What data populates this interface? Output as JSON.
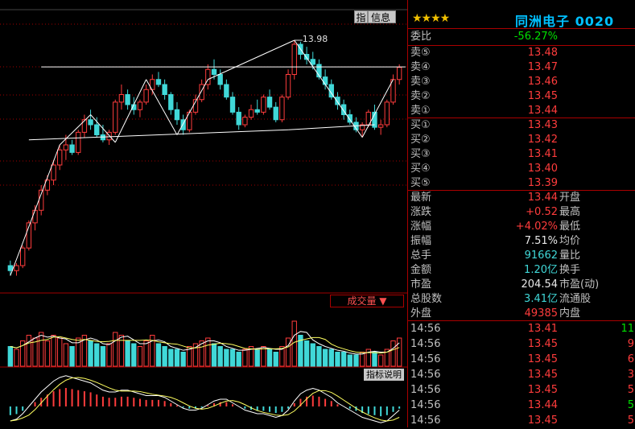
{
  "chart": {
    "buttons": {
      "zhi": "指",
      "info": "信息"
    },
    "high_label": "13.98",
    "volume_label": "成交量 ▼",
    "indicator_button": "指标说明"
  },
  "stock": {
    "stars": "★★★★",
    "title": "同洲电子 0020",
    "weibi": {
      "label": "委比",
      "value": "-56.27%"
    },
    "asks": [
      {
        "label": "卖⑤",
        "price": "13.48"
      },
      {
        "label": "卖④",
        "price": "13.47"
      },
      {
        "label": "卖③",
        "price": "13.46"
      },
      {
        "label": "卖②",
        "price": "13.45"
      },
      {
        "label": "卖①",
        "price": "13.44"
      }
    ],
    "bids": [
      {
        "label": "买①",
        "price": "13.43"
      },
      {
        "label": "买②",
        "price": "13.42"
      },
      {
        "label": "买③",
        "price": "13.41"
      },
      {
        "label": "买④",
        "price": "13.40"
      },
      {
        "label": "买⑤",
        "price": "13.39"
      }
    ],
    "stats": [
      {
        "label": "最新",
        "value": "13.44",
        "label2": "开盘",
        "color": "red"
      },
      {
        "label": "涨跌",
        "value": "+0.52",
        "label2": "最高",
        "color": "red"
      },
      {
        "label": "涨幅",
        "value": "+4.02%",
        "label2": "最低",
        "color": "red"
      },
      {
        "label": "振幅",
        "value": "7.51%",
        "label2": "均价",
        "color": "white"
      },
      {
        "label": "总手",
        "value": "91662",
        "label2": "量比",
        "color": "cyan"
      },
      {
        "label": "金额",
        "value": "1.20亿",
        "label2": "换手",
        "color": "cyan"
      },
      {
        "label": "市盈",
        "value": "204.54",
        "label2": "市盈(动)",
        "color": "white"
      },
      {
        "label": "总股数",
        "value": "3.41亿",
        "label2": "流通股",
        "color": "cyan"
      },
      {
        "label": "外盘",
        "value": "49385",
        "label2": "内盘",
        "color": "red"
      }
    ],
    "ticks": [
      {
        "time": "14:56",
        "price": "13.41",
        "vol": "11",
        "color": "green"
      },
      {
        "time": "14:56",
        "price": "13.45",
        "vol": "9",
        "color": "red"
      },
      {
        "time": "14:56",
        "price": "13.45",
        "vol": "6",
        "color": "red"
      },
      {
        "time": "14:56",
        "price": "13.45",
        "vol": "3",
        "color": "red"
      },
      {
        "time": "14:56",
        "price": "13.45",
        "vol": "5",
        "color": "red"
      },
      {
        "time": "14:56",
        "price": "13.44",
        "vol": "5",
        "color": "green"
      },
      {
        "time": "14:56",
        "price": "13.45",
        "vol": "5",
        "color": "red"
      }
    ]
  },
  "chart_data": {
    "type": "candlestick",
    "title": "",
    "high_marker": 13.98,
    "colors": {
      "up": "#ff3c3c",
      "down": "#40d8d8",
      "trendline": "#ffffff",
      "grid": "#a00000"
    },
    "candles": [
      [
        9.5,
        9.6,
        9.3,
        9.4
      ],
      [
        9.4,
        9.55,
        9.3,
        9.5
      ],
      [
        9.5,
        9.9,
        9.45,
        9.85
      ],
      [
        9.85,
        10.4,
        9.8,
        10.35
      ],
      [
        10.35,
        10.7,
        10.2,
        10.6
      ],
      [
        10.6,
        11.1,
        10.5,
        11.0
      ],
      [
        11.0,
        11.3,
        10.9,
        11.2
      ],
      [
        11.2,
        11.6,
        11.1,
        11.5
      ],
      [
        11.5,
        11.9,
        11.4,
        11.8
      ],
      [
        11.8,
        12.1,
        11.6,
        11.9
      ],
      [
        11.9,
        12.0,
        11.7,
        11.75
      ],
      [
        11.75,
        12.2,
        11.7,
        12.15
      ],
      [
        12.15,
        12.5,
        12.05,
        12.4
      ],
      [
        12.4,
        12.6,
        12.2,
        12.3
      ],
      [
        12.3,
        12.45,
        12.05,
        12.1
      ],
      [
        12.1,
        12.3,
        11.95,
        12.0
      ],
      [
        12.0,
        12.2,
        11.9,
        12.15
      ],
      [
        12.15,
        12.8,
        12.1,
        12.75
      ],
      [
        12.75,
        13.1,
        12.6,
        12.9
      ],
      [
        12.9,
        13.0,
        12.6,
        12.7
      ],
      [
        12.7,
        12.85,
        12.5,
        12.6
      ],
      [
        12.6,
        12.8,
        12.45,
        12.75
      ],
      [
        12.75,
        13.1,
        12.7,
        13.0
      ],
      [
        13.0,
        13.3,
        12.9,
        13.2
      ],
      [
        13.2,
        13.35,
        13.05,
        13.1
      ],
      [
        13.1,
        13.2,
        12.8,
        12.9
      ],
      [
        12.9,
        12.95,
        12.5,
        12.6
      ],
      [
        12.6,
        12.75,
        12.3,
        12.4
      ],
      [
        12.4,
        12.5,
        12.1,
        12.2
      ],
      [
        12.2,
        12.6,
        12.15,
        12.55
      ],
      [
        12.55,
        12.9,
        12.5,
        12.8
      ],
      [
        12.8,
        13.2,
        12.75,
        13.1
      ],
      [
        13.1,
        13.5,
        13.0,
        13.4
      ],
      [
        13.4,
        13.6,
        13.2,
        13.3
      ],
      [
        13.3,
        13.4,
        13.0,
        13.1
      ],
      [
        13.1,
        13.2,
        12.8,
        12.85
      ],
      [
        12.85,
        12.95,
        12.5,
        12.55
      ],
      [
        12.55,
        12.65,
        12.2,
        12.3
      ],
      [
        12.3,
        12.5,
        12.25,
        12.45
      ],
      [
        12.45,
        12.7,
        12.4,
        12.6
      ],
      [
        12.6,
        12.8,
        12.5,
        12.55
      ],
      [
        12.55,
        12.9,
        12.5,
        12.85
      ],
      [
        12.85,
        13.0,
        12.6,
        12.65
      ],
      [
        12.65,
        12.75,
        12.35,
        12.4
      ],
      [
        12.4,
        12.9,
        12.35,
        12.85
      ],
      [
        12.85,
        13.4,
        12.8,
        13.3
      ],
      [
        13.3,
        13.98,
        13.2,
        13.9
      ],
      [
        13.9,
        13.95,
        13.6,
        13.7
      ],
      [
        13.7,
        13.85,
        13.5,
        13.6
      ],
      [
        13.6,
        13.75,
        13.4,
        13.5
      ],
      [
        13.5,
        13.6,
        13.2,
        13.25
      ],
      [
        13.25,
        13.4,
        13.0,
        13.1
      ],
      [
        13.1,
        13.2,
        12.8,
        12.85
      ],
      [
        12.85,
        12.95,
        12.6,
        12.7
      ],
      [
        12.7,
        12.8,
        12.4,
        12.5
      ],
      [
        12.5,
        12.6,
        12.3,
        12.35
      ],
      [
        12.35,
        12.45,
        12.15,
        12.2
      ],
      [
        12.2,
        12.35,
        12.05,
        12.3
      ],
      [
        12.3,
        12.6,
        12.25,
        12.55
      ],
      [
        12.55,
        12.7,
        12.2,
        12.25
      ],
      [
        12.25,
        12.4,
        12.1,
        12.3
      ],
      [
        12.3,
        12.8,
        12.25,
        12.75
      ],
      [
        12.75,
        13.3,
        12.7,
        13.2
      ],
      [
        13.2,
        13.5,
        13.1,
        13.44
      ]
    ],
    "volumes": [
      0.35,
      0.3,
      0.45,
      0.55,
      0.5,
      0.6,
      0.45,
      0.55,
      0.5,
      0.4,
      0.35,
      0.5,
      0.55,
      0.45,
      0.4,
      0.35,
      0.4,
      0.6,
      0.55,
      0.45,
      0.4,
      0.35,
      0.45,
      0.55,
      0.4,
      0.35,
      0.3,
      0.3,
      0.25,
      0.35,
      0.4,
      0.45,
      0.5,
      0.4,
      0.35,
      0.3,
      0.3,
      0.25,
      0.3,
      0.35,
      0.3,
      0.35,
      0.3,
      0.25,
      0.35,
      0.5,
      0.8,
      0.55,
      0.45,
      0.4,
      0.35,
      0.3,
      0.3,
      0.25,
      0.25,
      0.2,
      0.2,
      0.25,
      0.3,
      0.25,
      0.2,
      0.3,
      0.45,
      0.5
    ],
    "indicator": [
      -0.4,
      -0.35,
      -0.2,
      0.0,
      0.2,
      0.4,
      0.55,
      0.7,
      0.8,
      0.85,
      0.8,
      0.75,
      0.7,
      0.65,
      0.55,
      0.45,
      0.4,
      0.4,
      0.45,
      0.45,
      0.4,
      0.35,
      0.3,
      0.3,
      0.3,
      0.25,
      0.15,
      0.05,
      -0.05,
      -0.1,
      -0.1,
      -0.05,
      0.05,
      0.15,
      0.2,
      0.2,
      0.1,
      0.0,
      -0.1,
      -0.15,
      -0.2,
      -0.2,
      -0.25,
      -0.3,
      -0.25,
      -0.1,
      0.15,
      0.35,
      0.45,
      0.5,
      0.45,
      0.35,
      0.25,
      0.1,
      0.0,
      -0.1,
      -0.2,
      -0.3,
      -0.35,
      -0.4,
      -0.45,
      -0.4,
      -0.25,
      -0.1
    ],
    "trendlines": [
      {
        "from": [
          0,
          9.3
        ],
        "to": [
          8,
          11.9
        ]
      },
      {
        "from": [
          8,
          11.9
        ],
        "to": [
          13,
          12.5
        ]
      },
      {
        "from": [
          13,
          12.5
        ],
        "to": [
          17,
          11.95
        ]
      },
      {
        "from": [
          17,
          11.95
        ],
        "to": [
          22,
          13.2
        ]
      },
      {
        "from": [
          22,
          13.2
        ],
        "to": [
          27,
          12.1
        ]
      },
      {
        "from": [
          27,
          12.1
        ],
        "to": [
          32,
          13.2
        ]
      },
      {
        "from": [
          32,
          13.2
        ],
        "to": [
          46,
          13.98
        ]
      },
      {
        "from": [
          46,
          13.98
        ],
        "to": [
          57,
          12.05
        ]
      },
      {
        "from": [
          57,
          12.05
        ],
        "to": [
          62,
          13.2
        ]
      },
      {
        "from": [
          3,
          12.0
        ],
        "to": [
          45,
          12.2
        ]
      },
      {
        "from": [
          45,
          12.2
        ],
        "to": [
          59,
          12.3
        ]
      },
      {
        "from": [
          5,
          13.45
        ],
        "to": [
          64,
          13.45
        ]
      }
    ]
  }
}
